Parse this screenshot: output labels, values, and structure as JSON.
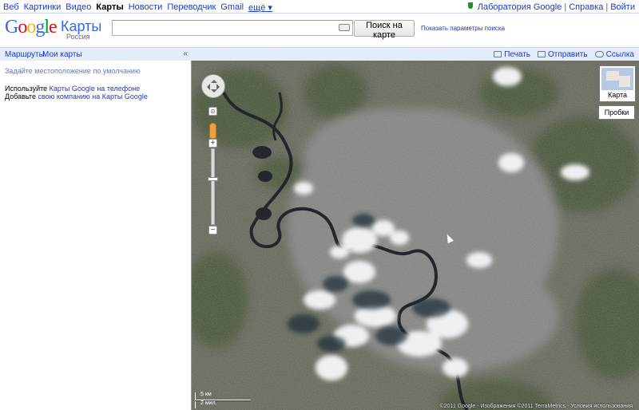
{
  "nav": {
    "items": [
      "Веб",
      "Картинки",
      "Видео",
      "Карты",
      "Новости",
      "Переводчик",
      "Gmail"
    ],
    "current": "Карты",
    "more": "ещё ▾",
    "right": {
      "labs": "Лаборатория Google",
      "help": "Справка",
      "login": "Войти"
    }
  },
  "logo": {
    "word": "Google",
    "product": "Карты",
    "region": "Россия"
  },
  "search": {
    "value": "",
    "button": "Поиск на карте",
    "options": "Показать параметры поиска"
  },
  "left_panel": {
    "tabs": {
      "routes": "Маршруты",
      "my_maps": "Мои карты"
    },
    "collapse": "«",
    "set_location": "Задайте местоположение по умолчанию",
    "phone_prefix": "Используйте ",
    "phone_link": "Карты Google на телефоне",
    "biz_prefix": "Добавьте ",
    "biz_link": "свою компанию на Карты Google"
  },
  "map_toolbar": {
    "print": "Печать",
    "send": "Отправить",
    "link": "Ссылка"
  },
  "map": {
    "type_toggle": "Карта",
    "traffic": "Пробки",
    "scale_km": "5 км",
    "scale_mi": "2 мил.",
    "attribution": "©2011 Google - Изображения ©2011 TerraMetrics - Условия использования",
    "controls": {
      "zoom_in": "+",
      "zoom_out": "−",
      "reset": "⊙",
      "zoom_level": 0.6
    }
  }
}
